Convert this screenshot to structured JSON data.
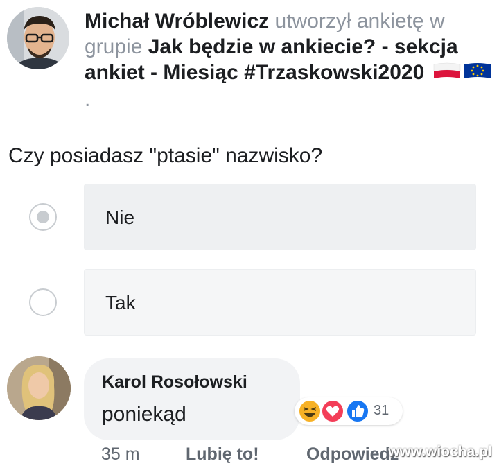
{
  "post": {
    "author": "Michał Wróblewicz",
    "action_text": "utworzył ankietę w grupie",
    "group": "Jak będzie w ankiecie? - sekcja ankiet - Miesiąc #Trzaskowski2020",
    "trailing_dot": ".",
    "question": "Czy posiadasz \"ptasie\" nazwisko?",
    "options": [
      {
        "label": "Nie",
        "selected": true
      },
      {
        "label": "Tak",
        "selected": false
      }
    ]
  },
  "comment": {
    "author": "Karol Rosołowski",
    "text": "poniekąd",
    "reaction_icons": [
      "haha-icon",
      "love-icon",
      "like-icon"
    ],
    "reaction_count": "31",
    "time": "35 m",
    "like_label": "Lubię to!",
    "reply_label": "Odpowiedz"
  },
  "watermark": "www.wiocha.pl",
  "colors": {
    "text": "#1c1e21",
    "muted": "#8d949e",
    "option_bg": "#f5f6f7",
    "like_blue": "#1877f2",
    "love_red": "#f33e58",
    "haha_yellow": "#f7b125"
  }
}
